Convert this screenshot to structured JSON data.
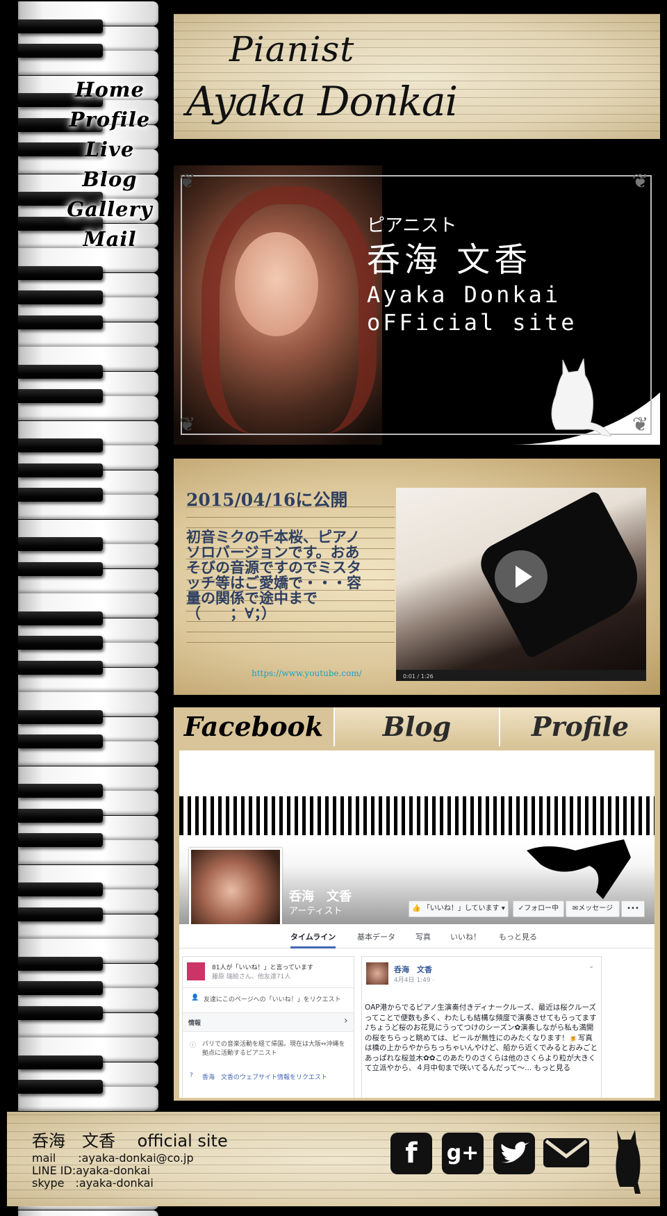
{
  "nav": [
    "Home",
    "Profile",
    "Live",
    "Blog",
    "Gallery",
    "Mail"
  ],
  "banner": {
    "line1": "Pianist",
    "line2": "Ayaka Donkai"
  },
  "hero": {
    "kana": "ピアニスト",
    "name_jp": "呑海 文香",
    "name_en_1": "Ayaka Donkai",
    "name_en_2": "oFFicial site"
  },
  "video": {
    "date": "2015/04/16に公開",
    "description": "初音ミクの千本桜、ピアノソロバージョンです。おあそびの音源ですのでミスタッチ等はご愛嬌で・・・容量の関係で途中まで（　　；∀；）",
    "url": "https://www.youtube.com/",
    "time": "0:01 / 1:26"
  },
  "tabs": [
    "Facebook",
    "Blog",
    "Profile"
  ],
  "facebook": {
    "page_name": "呑海　文香",
    "category": "アーティスト",
    "like_button": "「いいね！」しています",
    "follow_button": "フォロー中",
    "message_button": "メッセージ",
    "more_button": "•••",
    "nav": [
      "タイムライン",
      "基本データ",
      "写真",
      "いいね！",
      "もっと見る"
    ],
    "likes_text": "81人が「いいね！」と言っています",
    "likes_sub": "藤原 瑞絵さん、他友達71人",
    "invite_text": "友達にこのページへの「いいね！」をリクエスト",
    "info_label": "情報",
    "about_text": "パリでの音楽活動を経て帰国。現在は大阪⇔沖縄を拠点に活動するピアニスト",
    "website_request": "香海　文香のウェブサイト情報をリクエスト",
    "post_author": "呑海　文香",
    "post_date": "4月4日 1:49 ·",
    "post_text": "OAP港からでるピアノ生演奏付きディナークルーズ、最近は桜クルーズってことで便数も多く、わたしも結構な頻度で演奏させてもらってます♪ちょうど桜のお花見にうってつけのシーズン✿演奏しながら私も満開の桜をちらっと眺めては、ビールが無性にのみたくなります！🍺写真は橋の上からやからちっちゃいんやけど、船から近くでみるとおみごとあっぱれな桜並木✿✿このあたりのさくらは他のさくらより粒が大きくて立派やから、４月中旬まで咲いてるんだって〜... もっと見る"
  },
  "footer": {
    "site_title": "呑海　文香　 official site",
    "mail": "mail　　:ayaka-donkai@co.jp",
    "line": "LINE ID:ayaka-donkai",
    "skype": "skype　:ayaka-donkai"
  },
  "social": [
    "facebook-icon",
    "google-plus-icon",
    "twitter-icon",
    "mail-icon",
    "cat-icon"
  ]
}
